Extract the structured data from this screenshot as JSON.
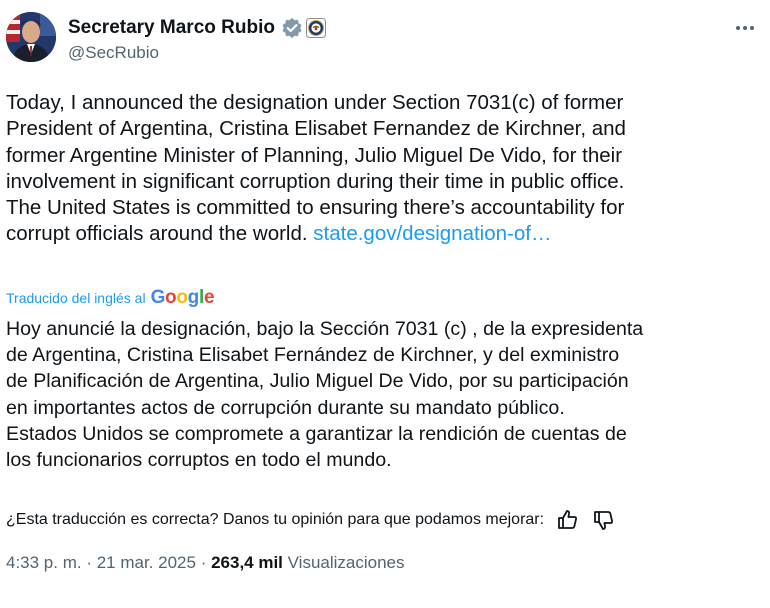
{
  "author": {
    "display_name": "Secretary Marco Rubio",
    "handle": "@SecRubio",
    "verified_badge_icon": "verified-checkmark-gray",
    "affiliation_icon": "us-state-department-seal",
    "avatar_icon": "profile-photo"
  },
  "more_icon": "more-horizontal-icon",
  "tweet": {
    "text_before_link": "Today, I announced the designation under Section 7031(c) of former\nPresident of Argentina, Cristina Elisabet Fernandez de Kirchner, and\nformer Argentine Minister of Planning, Julio Miguel De Vido, for their\ninvolvement in significant corruption during their time in public office.\nThe United States is committed to ensuring there’s accountability for\ncorrupt officials around the world. ",
    "link_text": "state.gov/designation-of…"
  },
  "translation": {
    "label": "Traducido del inglés al",
    "provider_letters": [
      "G",
      "o",
      "o",
      "g",
      "l",
      "e"
    ],
    "text": "Hoy anuncié la designación, bajo la Sección 7031 (c) , de la expresidenta\nde Argentina, Cristina Elisabet Fernández de Kirchner, y del exministro\nde Planificación de Argentina, Julio Miguel De Vido, por su participación\nen importantes actos de corrupción durante su mandato público.\nEstados Unidos se compromete a garantizar la rendición de cuentas de\nlos funcionarios corruptos en todo el mundo."
  },
  "feedback": {
    "question": "¿Esta traducción es correcta? Danos tu opinión para que podamos mejorar:",
    "thumbs_up_icon": "thumbs-up-icon",
    "thumbs_down_icon": "thumbs-down-icon"
  },
  "meta": {
    "time": "4:33 p. m.",
    "separator": " · ",
    "date": "21 mar. 2025",
    "views_count": "263,4 mil",
    "views_label": "Visualizaciones"
  },
  "colors": {
    "link": "#1d9bf0",
    "secondary_text": "#536471",
    "primary_text": "#0f1419"
  }
}
